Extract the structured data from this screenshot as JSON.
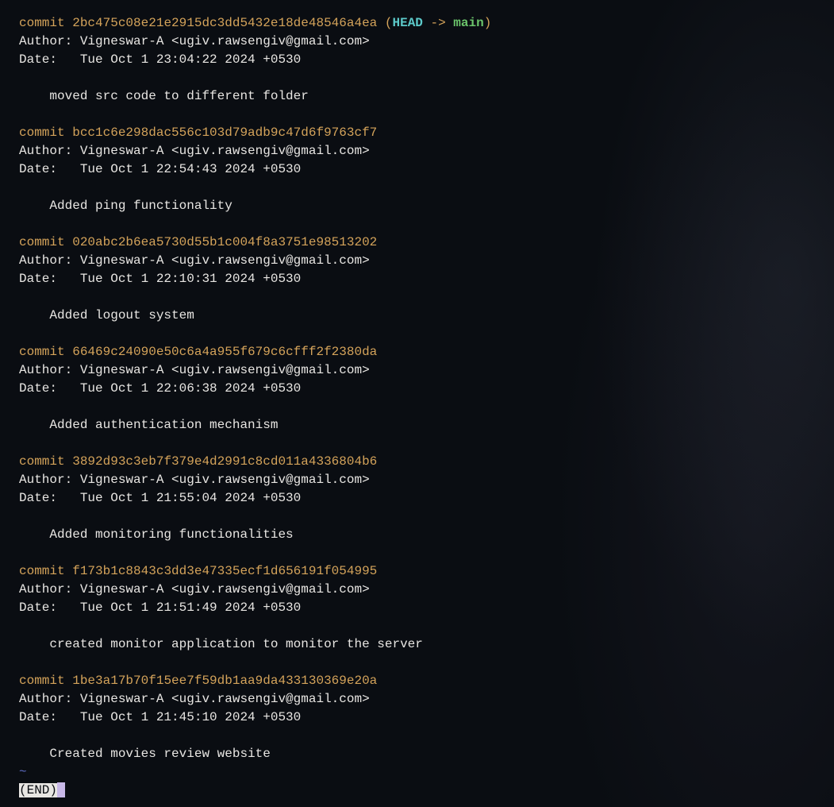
{
  "refs": {
    "head": "HEAD",
    "arrow": " -> ",
    "branch": "main"
  },
  "commits": [
    {
      "hash": "2bc475c08e21e2915dc3dd5432e18de48546a4ea",
      "hasRefs": true,
      "author": "Author: Vigneswar-A <ugiv.rawsengiv@gmail.com>",
      "date": "Date:   Tue Oct 1 23:04:22 2024 +0530",
      "message": "    moved src code to different folder"
    },
    {
      "hash": "bcc1c6e298dac556c103d79adb9c47d6f9763cf7",
      "hasRefs": false,
      "author": "Author: Vigneswar-A <ugiv.rawsengiv@gmail.com>",
      "date": "Date:   Tue Oct 1 22:54:43 2024 +0530",
      "message": "    Added ping functionality"
    },
    {
      "hash": "020abc2b6ea5730d55b1c004f8a3751e98513202",
      "hasRefs": false,
      "author": "Author: Vigneswar-A <ugiv.rawsengiv@gmail.com>",
      "date": "Date:   Tue Oct 1 22:10:31 2024 +0530",
      "message": "    Added logout system"
    },
    {
      "hash": "66469c24090e50c6a4a955f679c6cfff2f2380da",
      "hasRefs": false,
      "author": "Author: Vigneswar-A <ugiv.rawsengiv@gmail.com>",
      "date": "Date:   Tue Oct 1 22:06:38 2024 +0530",
      "message": "    Added authentication mechanism"
    },
    {
      "hash": "3892d93c3eb7f379e4d2991c8cd011a4336804b6",
      "hasRefs": false,
      "author": "Author: Vigneswar-A <ugiv.rawsengiv@gmail.com>",
      "date": "Date:   Tue Oct 1 21:55:04 2024 +0530",
      "message": "    Added monitoring functionalities"
    },
    {
      "hash": "f173b1c8843c3dd3e47335ecf1d656191f054995",
      "hasRefs": false,
      "author": "Author: Vigneswar-A <ugiv.rawsengiv@gmail.com>",
      "date": "Date:   Tue Oct 1 21:51:49 2024 +0530",
      "message": "    created monitor application to monitor the server"
    },
    {
      "hash": "1be3a17b70f15ee7f59db1aa9da433130369e20a",
      "hasRefs": false,
      "author": "Author: Vigneswar-A <ugiv.rawsengiv@gmail.com>",
      "date": "Date:   Tue Oct 1 21:45:10 2024 +0530",
      "message": "    Created movies review website"
    }
  ],
  "commitKeyword": "commit ",
  "tilde": "~",
  "endMarker": "(END)"
}
